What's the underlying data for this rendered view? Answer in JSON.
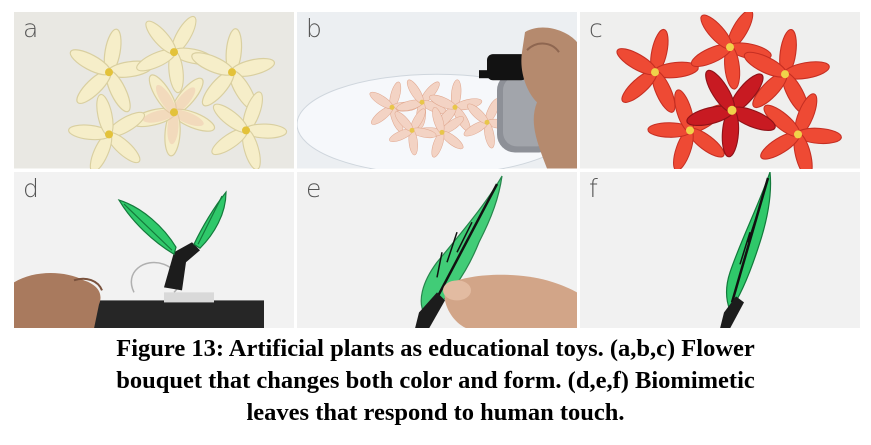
{
  "figure": {
    "panels": [
      {
        "label": "a",
        "content": "cream-flowers"
      },
      {
        "label": "b",
        "content": "spraying-flowers"
      },
      {
        "label": "c",
        "content": "red-flowers"
      },
      {
        "label": "d",
        "content": "leaf-on-board"
      },
      {
        "label": "e",
        "content": "leaf-touched"
      },
      {
        "label": "f",
        "content": "leaf-folded"
      }
    ],
    "caption_lines": [
      "Figure 13: Artificial plants as educational toys. (a,b,c) Flower",
      "bouquet that changes both color and form. (d,e,f) Biomimetic",
      "leaves that respond to human touch."
    ]
  },
  "colors": {
    "cream_petal": "#f5ecc8",
    "red_petal": "#e8422f",
    "deep_red_petal": "#c81e24",
    "leaf_green": "#2fc86a",
    "stem_black": "#1c1c1c"
  }
}
